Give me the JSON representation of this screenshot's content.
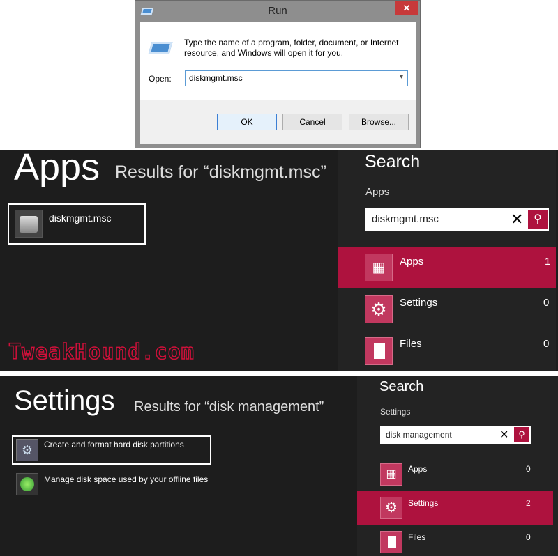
{
  "run_dialog": {
    "title": "Run",
    "close_label": "✕",
    "description": "Type the name of a program, folder, document, or Internet resource, and Windows will open it for you.",
    "open_label": "Open:",
    "open_value": "diskmgmt.msc",
    "ok_label": "OK",
    "cancel_label": "Cancel",
    "browse_label": "Browse..."
  },
  "apps_search": {
    "heading": "Apps",
    "results_for": "Results for “diskmgmt.msc”",
    "results": [
      {
        "label": "diskmgmt.msc",
        "icon": "disk-management-icon"
      }
    ],
    "watermark": "TweakHound.com",
    "pane": {
      "title": "Search",
      "scope": "Apps",
      "query": "diskmgmt.msc",
      "categories": [
        {
          "label": "Apps",
          "count": "1",
          "icon": "apps-icon",
          "selected": true
        },
        {
          "label": "Settings",
          "count": "0",
          "icon": "gear-icon",
          "selected": false
        },
        {
          "label": "Files",
          "count": "0",
          "icon": "file-icon",
          "selected": false
        }
      ]
    }
  },
  "settings_search": {
    "heading": "Settings",
    "results_for": "Results for “disk management”",
    "results": [
      {
        "label": "Create and format hard disk partitions",
        "icon": "disk-partition-icon"
      },
      {
        "label": "Manage disk space used by your offline files",
        "icon": "sync-icon"
      }
    ],
    "pane": {
      "title": "Search",
      "scope": "Settings",
      "query": "disk management",
      "categories": [
        {
          "label": "Apps",
          "count": "0",
          "icon": "apps-icon",
          "selected": false
        },
        {
          "label": "Settings",
          "count": "2",
          "icon": "gear-icon",
          "selected": true
        },
        {
          "label": "Files",
          "count": "0",
          "icon": "file-icon",
          "selected": false
        }
      ]
    }
  },
  "colors": {
    "accent": "#ae123e",
    "tile": "#c1385f",
    "background": "#1d1d1d"
  }
}
